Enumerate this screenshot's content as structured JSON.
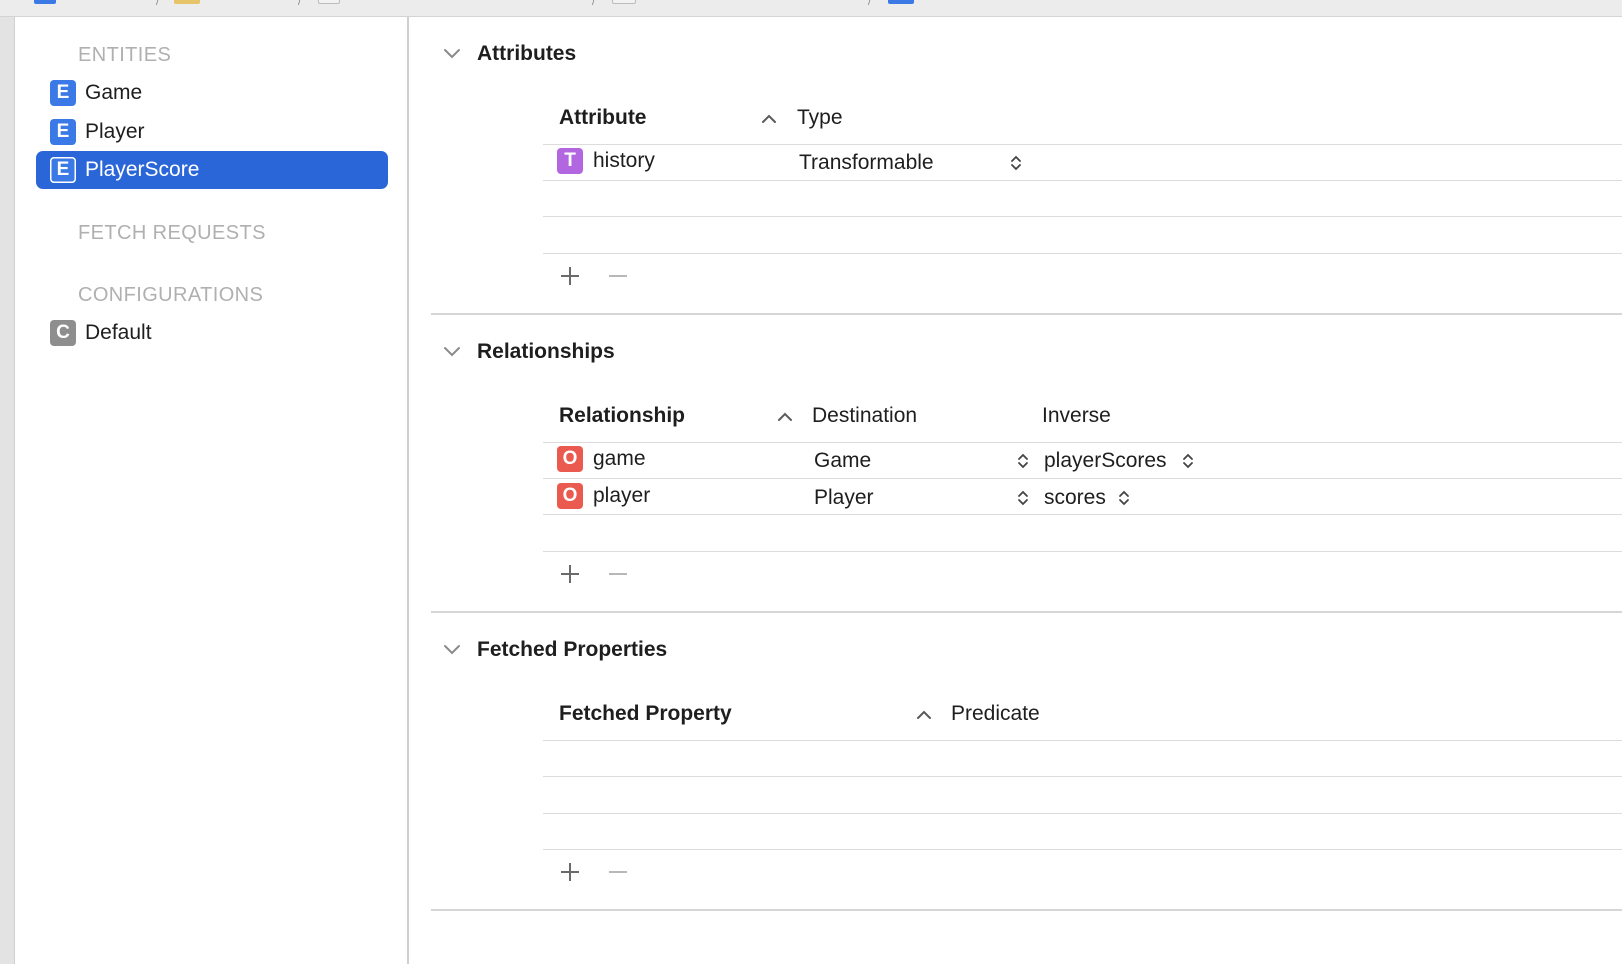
{
  "sidebar": {
    "entities_header": "ENTITIES",
    "entities": [
      {
        "label": "Game",
        "badge": "E"
      },
      {
        "label": "Player",
        "badge": "E"
      },
      {
        "label": "PlayerScore",
        "badge": "E",
        "selected": true
      }
    ],
    "fetch_requests_header": "FETCH REQUESTS",
    "configurations_header": "CONFIGURATIONS",
    "configurations": [
      {
        "label": "Default",
        "badge": "C"
      }
    ]
  },
  "attributes": {
    "title": "Attributes",
    "col_attribute": "Attribute",
    "col_type": "Type",
    "rows": [
      {
        "badge": "T",
        "name": "history",
        "type": "Transformable"
      }
    ]
  },
  "relationships": {
    "title": "Relationships",
    "col_relationship": "Relationship",
    "col_destination": "Destination",
    "col_inverse": "Inverse",
    "rows": [
      {
        "badge": "O",
        "name": "game",
        "destination": "Game",
        "inverse": "playerScores"
      },
      {
        "badge": "O",
        "name": "player",
        "destination": "Player",
        "inverse": "scores"
      }
    ]
  },
  "fetched_properties": {
    "title": "Fetched Properties",
    "col_fetched_property": "Fetched Property",
    "col_predicate": "Predicate"
  },
  "colors": {
    "selection": "#2b66d9",
    "entity_badge": "#3a79e6",
    "attribute_badge": "#b267e0",
    "relationship_badge": "#ea5a4e",
    "config_badge": "#8e8e8e"
  }
}
